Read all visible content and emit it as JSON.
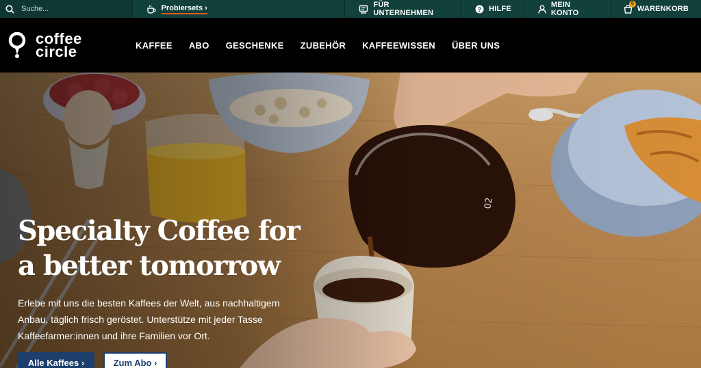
{
  "topbar": {
    "search_placeholder": "Suche...",
    "probiersets_label": "Probiersets ›",
    "business_label": "FÜR UNTERNEHMEN",
    "help_label": "HILFE",
    "account_label": "MEIN KONTO",
    "cart_label": "WARENKORB",
    "cart_count": "0"
  },
  "logo": {
    "line1": "coffee",
    "line2": "circle"
  },
  "nav": {
    "items": [
      "KAFFEE",
      "ABO",
      "GESCHENKE",
      "ZUBEHÖR",
      "KAFFEEWISSEN",
      "ÜBER UNS"
    ]
  },
  "hero": {
    "headline": "Specialty Coffee for a better tomorrow",
    "subline": "Erlebe mit uns die besten Kaffees der Welt, aus nachhaltigem Anbau, täglich frisch geröstet. Unterstütze mit jeder Tasse Kaffeefarmer:innen und ihre Familien vor Ort.",
    "primary_button": "Alle Kaffees ›",
    "secondary_button": "Zum Abo ›",
    "carafe_marking": "02"
  },
  "colors": {
    "topbar_bg": "#12403a",
    "accent_underline": "#e85a1c",
    "button_blue": "#1d3f6e",
    "cart_badge": "#e8a21c"
  },
  "icons": [
    "search-icon",
    "cup-icon",
    "business-icon",
    "help-icon",
    "user-icon",
    "cart-icon"
  ]
}
